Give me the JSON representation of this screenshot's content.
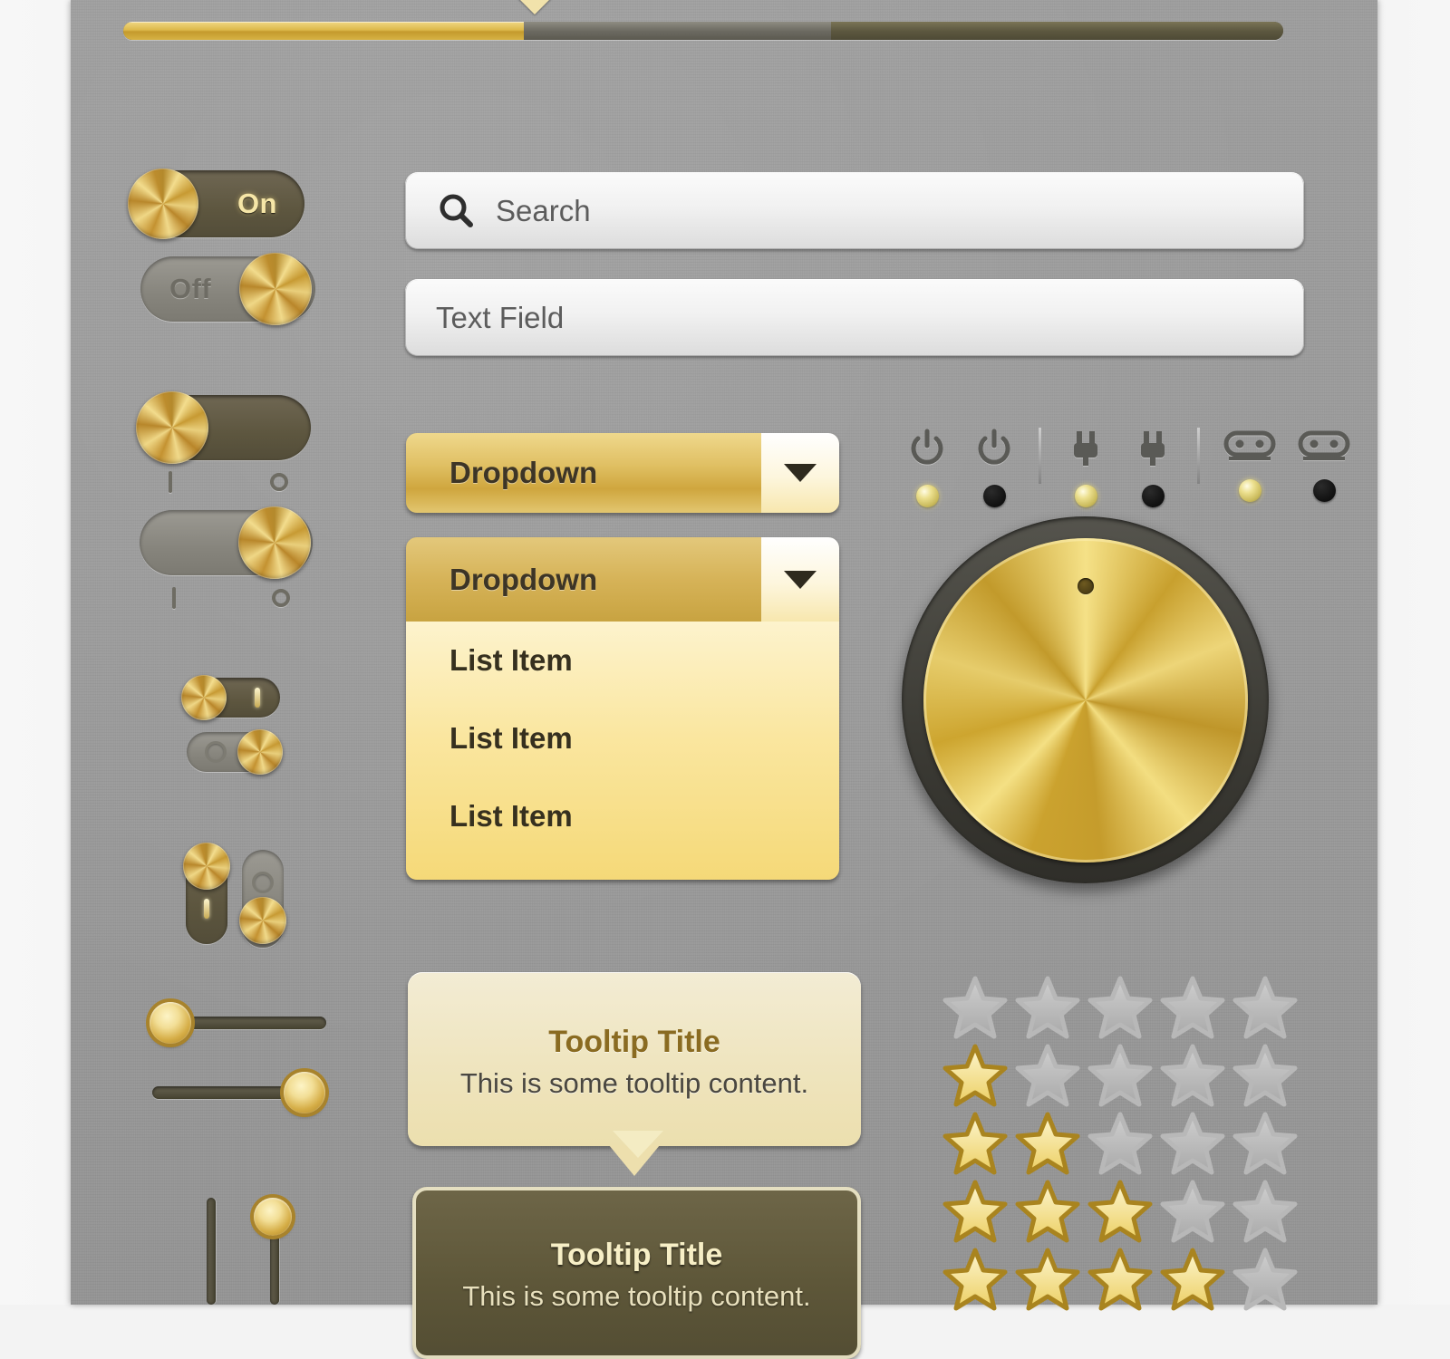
{
  "panel": {
    "background_color": "#9a9a9a",
    "accent_gold": "#d9b34f"
  },
  "progress": {
    "name": "progress-bar",
    "gold_percent": 34.5,
    "grey_percent": 26.5,
    "dark_percent": 39,
    "caret_label": "▼"
  },
  "toggles": [
    {
      "name": "toggle-on",
      "label": "On",
      "state": "on"
    },
    {
      "name": "toggle-off",
      "label": "Off",
      "state": "off"
    },
    {
      "name": "toggle-large-on",
      "label": "",
      "state": "on"
    },
    {
      "name": "toggle-large-off",
      "label": "",
      "state": "off"
    },
    {
      "name": "toggle-small-on",
      "label": "",
      "state": "on"
    },
    {
      "name": "toggle-small-off",
      "label": "",
      "state": "off"
    },
    {
      "name": "toggle-vertical-on",
      "label": "",
      "state": "on"
    },
    {
      "name": "toggle-vertical-off",
      "label": "",
      "state": "off"
    }
  ],
  "tick_marks": {
    "on_glyph": "I",
    "off_glyph": "O"
  },
  "sliders": [
    {
      "name": "slider-horizontal-min",
      "orientation": "horizontal",
      "value": 0
    },
    {
      "name": "slider-horizontal-max",
      "orientation": "horizontal",
      "value": 100
    },
    {
      "name": "slider-vertical-min",
      "orientation": "vertical",
      "value": 0
    },
    {
      "name": "slider-vertical-max",
      "orientation": "vertical",
      "value": 100
    }
  ],
  "search": {
    "placeholder": "Search",
    "value": "Search",
    "icon": "search-icon"
  },
  "text_field": {
    "placeholder": "Text Field",
    "value": "Text Field"
  },
  "dropdown_closed": {
    "label": "Dropdown",
    "caret": "▼"
  },
  "dropdown_open": {
    "label": "Dropdown",
    "caret": "▼",
    "items": [
      {
        "label": "List Item"
      },
      {
        "label": "List Item"
      },
      {
        "label": "List Item"
      }
    ]
  },
  "icon_banks": [
    {
      "name": "power-bank",
      "icon": "power-icon",
      "leds": [
        {
          "name": "led-power-on",
          "state": "on"
        },
        {
          "name": "led-power-off",
          "state": "off"
        }
      ]
    },
    {
      "name": "plug-bank",
      "icon": "plug-icon",
      "leds": [
        {
          "name": "led-plug-on",
          "state": "on"
        },
        {
          "name": "led-plug-off",
          "state": "off"
        }
      ]
    },
    {
      "name": "reel-bank",
      "icon": "tape-reel-icon",
      "leds": [
        {
          "name": "led-reel-on",
          "state": "on"
        },
        {
          "name": "led-reel-off",
          "state": "off"
        }
      ]
    }
  ],
  "knob": {
    "name": "rotary-knob",
    "indicator_position_degrees": 0
  },
  "tooltips": [
    {
      "name": "tooltip-light",
      "theme": "light",
      "title": "Tooltip Title",
      "body": "This is some tooltip content."
    },
    {
      "name": "tooltip-dark",
      "theme": "dark",
      "title": "Tooltip Title",
      "body": "This is some tooltip content."
    }
  ],
  "ratings": {
    "name": "star-rating-set",
    "max": 5,
    "rows": [
      0,
      1,
      2,
      3,
      4
    ]
  }
}
